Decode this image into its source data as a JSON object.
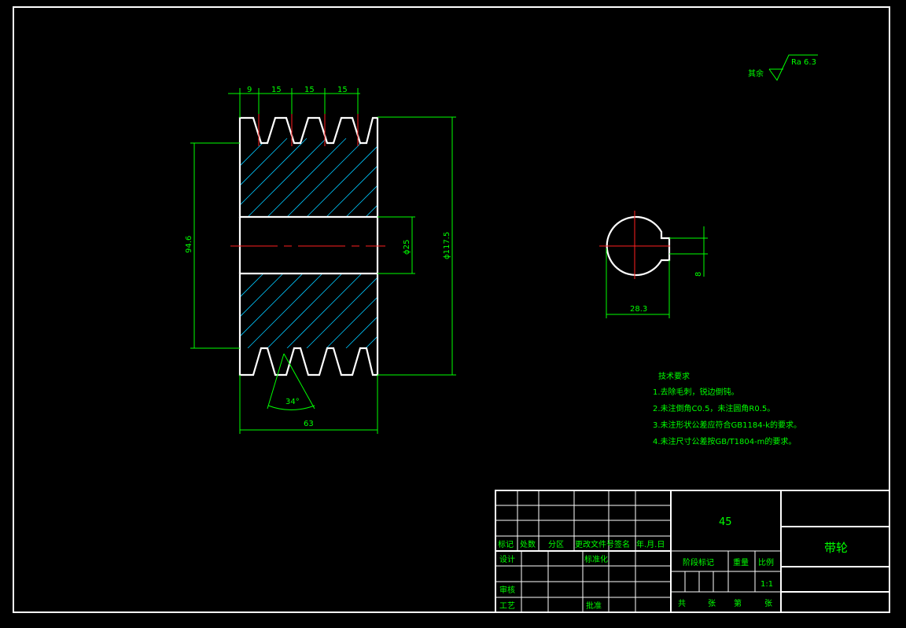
{
  "surface_finish": {
    "prefix": "其余",
    "value": "Ra 6.3"
  },
  "dims": {
    "top": [
      "9",
      "15",
      "15",
      "15"
    ],
    "d_groove": "94.6",
    "d_bore": "ϕ25",
    "d_outer": "ϕ117.5",
    "angle": "34°",
    "width": "63",
    "keyway_depth": "28.3",
    "keyway_width": "8"
  },
  "tech_req": {
    "title": "技术要求",
    "items": [
      "1.去除毛刺，锐边倒钝。",
      "2.未注倒角C0.5，未注圆角R0.5。",
      "3.未注形状公差应符合GB1184-k的要求。",
      "4.未注尺寸公差按GB/T1804-m的要求。"
    ]
  },
  "title_block": {
    "material": "45",
    "part_name": "带轮",
    "rev_headers": [
      "标记",
      "处数",
      "分区",
      "更改文件号",
      "签名",
      "年.月.日"
    ],
    "design": "设计",
    "standardize": "标准化",
    "review": "审核",
    "process": "工艺",
    "approve": "批准",
    "stage_mark": "阶段标记",
    "weight": "重量",
    "scale": "比例",
    "scale_value": "1:1",
    "total": "共",
    "sheets": "张",
    "page": "第",
    "sheet2": "张"
  }
}
